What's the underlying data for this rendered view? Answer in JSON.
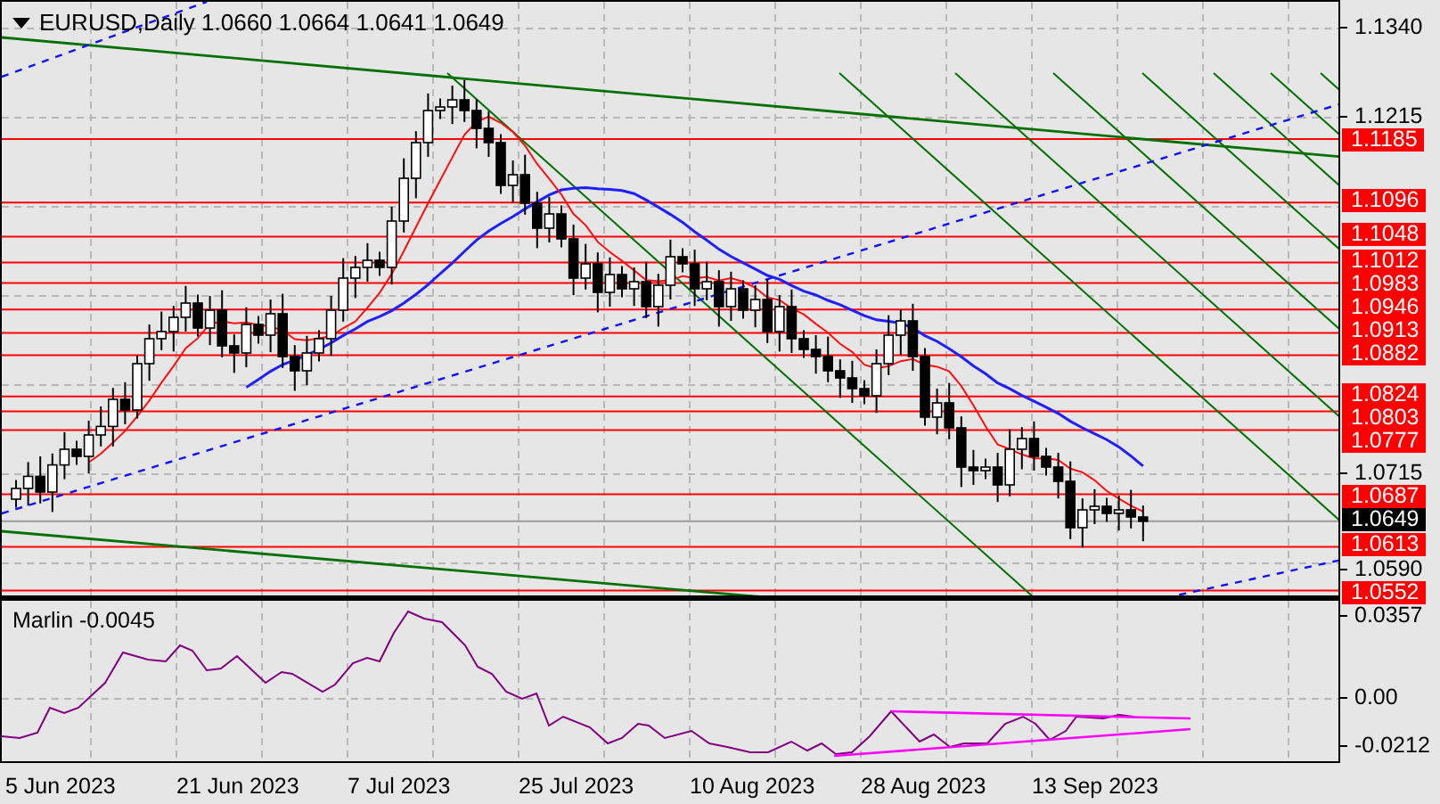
{
  "chart": {
    "symbol_timeframe": "EURUSD,Daily",
    "ohlc": [
      "1.0660",
      "1.0664",
      "1.0641",
      "1.0649"
    ],
    "price_ticks": [
      "1.1340",
      "1.1215",
      "1.0715",
      "1.0590"
    ],
    "levels": [
      {
        "label": "1.1185",
        "kind": "level"
      },
      {
        "label": "1.1096",
        "kind": "level"
      },
      {
        "label": "1.1048",
        "kind": "level"
      },
      {
        "label": "1.1012",
        "kind": "level"
      },
      {
        "label": "1.0983",
        "kind": "level"
      },
      {
        "label": "1.0946",
        "kind": "level"
      },
      {
        "label": "1.0913",
        "kind": "level"
      },
      {
        "label": "1.0882",
        "kind": "level"
      },
      {
        "label": "1.0824",
        "kind": "level"
      },
      {
        "label": "1.0803",
        "kind": "level"
      },
      {
        "label": "1.0777",
        "kind": "level"
      },
      {
        "label": "1.0687",
        "kind": "level"
      },
      {
        "label": "1.0649",
        "kind": "price"
      },
      {
        "label": "1.0613",
        "kind": "level"
      },
      {
        "label": "1.0552",
        "kind": "level"
      }
    ],
    "indicator": {
      "name": "Marlin",
      "value": "-0.0045",
      "ticks": [
        "0.0357",
        "0.00",
        "-0.0212"
      ]
    },
    "dates": [
      "5 Jun 2023",
      "21 Jun 2023",
      "7 Jul 2023",
      "25 Jul 2023",
      "10 Aug 2023",
      "28 Aug 2023",
      "13 Sep 2023"
    ]
  }
}
